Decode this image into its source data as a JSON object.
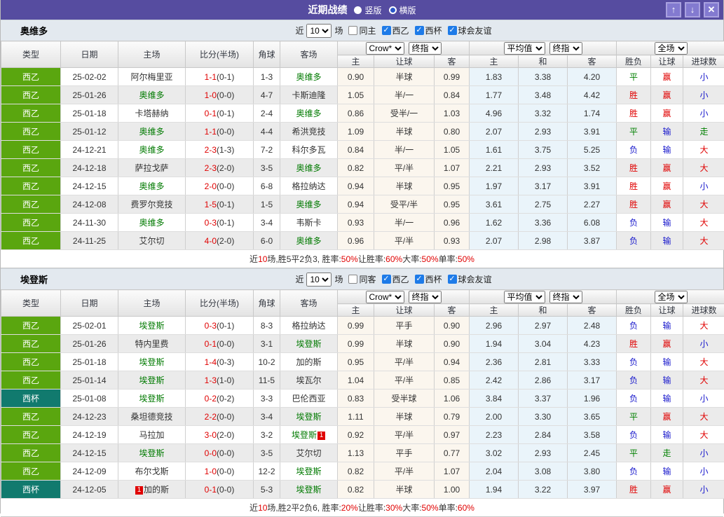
{
  "colors": {
    "titlebar_purple": "#564CA0",
    "button_purple": "#837AD0",
    "league_green": "#5AA60F",
    "league_teal": "#117A6E",
    "focus_team_green": "#007A00",
    "result_red": "#E00000",
    "result_blue": "#1818CC",
    "result_green": "#008000",
    "odds_cream_bg": "#FBF6EE",
    "avg_blue_bg": "#EAF4FA"
  },
  "result_color_map": {
    "胜": "red",
    "平": "green",
    "负": "blue",
    "赢": "red",
    "输": "blue",
    "走": "green",
    "大": "red",
    "小": "blue"
  },
  "league_style_map": {
    "西乙": "green",
    "西杯": "teal"
  },
  "titlebar": {
    "title": "近期战绩",
    "vertical_label": "竖版",
    "horizontal_label": "横版",
    "up_icon": "↑",
    "down_icon": "↓",
    "close_icon": "✕"
  },
  "controls_shared": {
    "near": "近",
    "count": "10",
    "games": "场",
    "league_cb": "西乙",
    "cup_cb": "西杯",
    "friendly_cb": "球会友谊"
  },
  "table_headers": {
    "type": "类型",
    "date": "日期",
    "home": "主场",
    "score": "比分(半场)",
    "corner": "角球",
    "away": "客场",
    "crow_select": "Crow*",
    "final_select": "终指",
    "avg_select": "平均值",
    "final_select2": "终指",
    "scope_select": "全场",
    "sub": {
      "home_odds": "主",
      "handicap": "让球",
      "away_odds": "客",
      "avg_home": "主",
      "avg_draw": "和",
      "avg_away": "客",
      "wdl": "胜负",
      "handicap_result": "让球",
      "goals": "进球数"
    }
  },
  "sections": [
    {
      "team": "奥维多",
      "same_label": "同主",
      "rows": [
        {
          "type": "西乙",
          "date": "25-02-02",
          "home": "阿尔梅里亚",
          "score": "1-1",
          "half": "(0-1)",
          "corner": "1-3",
          "away": "奥维多",
          "crow": [
            "0.90",
            "半球",
            "0.99"
          ],
          "avg": [
            "1.83",
            "3.38",
            "4.20"
          ],
          "result": [
            "平",
            "赢",
            "小"
          ]
        },
        {
          "type": "西乙",
          "date": "25-01-26",
          "home": "奥维多",
          "score": "1-0",
          "half": "(0-0)",
          "corner": "4-7",
          "away": "卡斯迪隆",
          "crow": [
            "1.05",
            "半/一",
            "0.84"
          ],
          "avg": [
            "1.77",
            "3.48",
            "4.42"
          ],
          "result": [
            "胜",
            "赢",
            "小"
          ]
        },
        {
          "type": "西乙",
          "date": "25-01-18",
          "home": "卡塔赫纳",
          "score": "0-1",
          "half": "(0-1)",
          "corner": "2-4",
          "away": "奥维多",
          "crow": [
            "0.86",
            "受半/一",
            "1.03"
          ],
          "avg": [
            "4.96",
            "3.32",
            "1.74"
          ],
          "result": [
            "胜",
            "赢",
            "小"
          ]
        },
        {
          "type": "西乙",
          "date": "25-01-12",
          "home": "奥维多",
          "score": "1-1",
          "half": "(0-0)",
          "corner": "4-4",
          "away": "希洪竞技",
          "crow": [
            "1.09",
            "半球",
            "0.80"
          ],
          "avg": [
            "2.07",
            "2.93",
            "3.91"
          ],
          "result": [
            "平",
            "输",
            "走"
          ]
        },
        {
          "type": "西乙",
          "date": "24-12-21",
          "home": "奥维多",
          "score": "2-3",
          "half": "(1-3)",
          "corner": "7-2",
          "away": "科尔多瓦",
          "crow": [
            "0.84",
            "半/一",
            "1.05"
          ],
          "avg": [
            "1.61",
            "3.75",
            "5.25"
          ],
          "result": [
            "负",
            "输",
            "大"
          ]
        },
        {
          "type": "西乙",
          "date": "24-12-18",
          "home": "萨拉戈萨",
          "score": "2-3",
          "half": "(2-0)",
          "corner": "3-5",
          "away": "奥维多",
          "crow": [
            "0.82",
            "平/半",
            "1.07"
          ],
          "avg": [
            "2.21",
            "2.93",
            "3.52"
          ],
          "result": [
            "胜",
            "赢",
            "大"
          ]
        },
        {
          "type": "西乙",
          "date": "24-12-15",
          "home": "奥维多",
          "score": "2-0",
          "half": "(0-0)",
          "corner": "6-8",
          "away": "格拉纳达",
          "crow": [
            "0.94",
            "半球",
            "0.95"
          ],
          "avg": [
            "1.97",
            "3.17",
            "3.91"
          ],
          "result": [
            "胜",
            "赢",
            "小"
          ]
        },
        {
          "type": "西乙",
          "date": "24-12-08",
          "home": "费罗尔竞技",
          "score": "1-5",
          "half": "(0-1)",
          "corner": "1-5",
          "away": "奥维多",
          "crow": [
            "0.94",
            "受平/半",
            "0.95"
          ],
          "avg": [
            "3.61",
            "2.75",
            "2.27"
          ],
          "result": [
            "胜",
            "赢",
            "大"
          ]
        },
        {
          "type": "西乙",
          "date": "24-11-30",
          "home": "奥维多",
          "score": "0-3",
          "half": "(0-1)",
          "corner": "3-4",
          "away": "韦斯卡",
          "crow": [
            "0.93",
            "半/一",
            "0.96"
          ],
          "avg": [
            "1.62",
            "3.36",
            "6.08"
          ],
          "result": [
            "负",
            "输",
            "大"
          ]
        },
        {
          "type": "西乙",
          "date": "24-11-25",
          "home": "艾尔切",
          "score": "4-0",
          "half": "(2-0)",
          "corner": "6-0",
          "away": "奥维多",
          "crow": [
            "0.96",
            "平/半",
            "0.93"
          ],
          "avg": [
            "2.07",
            "2.98",
            "3.87"
          ],
          "result": [
            "负",
            "输",
            "大"
          ]
        }
      ],
      "summary": [
        {
          "text": "近"
        },
        {
          "text": "10",
          "red": true
        },
        {
          "text": "场,胜5平2负3, 胜率:"
        },
        {
          "text": "50%",
          "red": true
        },
        {
          "text": " 让胜率:"
        },
        {
          "text": "60%",
          "red": true
        },
        {
          "text": " 大率:"
        },
        {
          "text": "50%",
          "red": true
        },
        {
          "text": " 单率:"
        },
        {
          "text": "50%",
          "red": true
        }
      ]
    },
    {
      "team": "埃登斯",
      "same_label": "同客",
      "rows": [
        {
          "type": "西乙",
          "date": "25-02-01",
          "home": "埃登斯",
          "score": "0-3",
          "half": "(0-1)",
          "corner": "8-3",
          "away": "格拉纳达",
          "crow": [
            "0.99",
            "平手",
            "0.90"
          ],
          "avg": [
            "2.96",
            "2.97",
            "2.48"
          ],
          "result": [
            "负",
            "输",
            "大"
          ]
        },
        {
          "type": "西乙",
          "date": "25-01-26",
          "home": "特内里费",
          "score": "0-1",
          "half": "(0-0)",
          "corner": "3-1",
          "away": "埃登斯",
          "crow": [
            "0.99",
            "半球",
            "0.90"
          ],
          "avg": [
            "1.94",
            "3.04",
            "4.23"
          ],
          "result": [
            "胜",
            "赢",
            "小"
          ]
        },
        {
          "type": "西乙",
          "date": "25-01-18",
          "home": "埃登斯",
          "score": "1-4",
          "half": "(0-3)",
          "corner": "10-2",
          "away": "加的斯",
          "crow": [
            "0.95",
            "平/半",
            "0.94"
          ],
          "avg": [
            "2.36",
            "2.81",
            "3.33"
          ],
          "result": [
            "负",
            "输",
            "大"
          ]
        },
        {
          "type": "西乙",
          "date": "25-01-14",
          "home": "埃登斯",
          "score": "1-3",
          "half": "(1-0)",
          "corner": "11-5",
          "away": "埃瓦尔",
          "crow": [
            "1.04",
            "平/半",
            "0.85"
          ],
          "avg": [
            "2.42",
            "2.86",
            "3.17"
          ],
          "result": [
            "负",
            "输",
            "大"
          ]
        },
        {
          "type": "西杯",
          "date": "25-01-08",
          "home": "埃登斯",
          "score": "0-2",
          "half": "(0-2)",
          "corner": "3-3",
          "away": "巴伦西亚",
          "crow": [
            "0.83",
            "受半球",
            "1.06"
          ],
          "avg": [
            "3.84",
            "3.37",
            "1.96"
          ],
          "result": [
            "负",
            "输",
            "小"
          ]
        },
        {
          "type": "西乙",
          "date": "24-12-23",
          "home": "桑坦德竞技",
          "score": "2-2",
          "half": "(0-0)",
          "corner": "3-4",
          "away": "埃登斯",
          "crow": [
            "1.11",
            "半球",
            "0.79"
          ],
          "avg": [
            "2.00",
            "3.30",
            "3.65"
          ],
          "result": [
            "平",
            "赢",
            "大"
          ]
        },
        {
          "type": "西乙",
          "date": "24-12-19",
          "home": "马拉加",
          "score": "3-0",
          "half": "(2-0)",
          "corner": "3-2",
          "away": "埃登斯",
          "away_badge": {
            "text": "1",
            "pos": "after"
          },
          "crow": [
            "0.92",
            "平/半",
            "0.97"
          ],
          "avg": [
            "2.23",
            "2.84",
            "3.58"
          ],
          "result": [
            "负",
            "输",
            "大"
          ]
        },
        {
          "type": "西乙",
          "date": "24-12-15",
          "home": "埃登斯",
          "score": "0-0",
          "half": "(0-0)",
          "corner": "3-5",
          "away": "艾尔切",
          "crow": [
            "1.13",
            "平手",
            "0.77"
          ],
          "avg": [
            "3.02",
            "2.93",
            "2.45"
          ],
          "result": [
            "平",
            "走",
            "小"
          ]
        },
        {
          "type": "西乙",
          "date": "24-12-09",
          "home": "布尔戈斯",
          "score": "1-0",
          "half": "(0-0)",
          "corner": "12-2",
          "away": "埃登斯",
          "crow": [
            "0.82",
            "平/半",
            "1.07"
          ],
          "avg": [
            "2.04",
            "3.08",
            "3.80"
          ],
          "result": [
            "负",
            "输",
            "小"
          ]
        },
        {
          "type": "西杯",
          "date": "24-12-05",
          "home": "加的斯",
          "home_badge": {
            "text": "1",
            "pos": "before"
          },
          "score": "0-1",
          "half": "(0-0)",
          "corner": "5-3",
          "away": "埃登斯",
          "crow": [
            "0.82",
            "半球",
            "1.00"
          ],
          "avg": [
            "1.94",
            "3.22",
            "3.97"
          ],
          "result": [
            "胜",
            "赢",
            "小"
          ]
        }
      ],
      "summary": [
        {
          "text": "近"
        },
        {
          "text": "10",
          "red": true
        },
        {
          "text": "场,胜2平2负6, 胜率:"
        },
        {
          "text": "20%",
          "red": true
        },
        {
          "text": " 让胜率:"
        },
        {
          "text": "30%",
          "red": true
        },
        {
          "text": " 大率:"
        },
        {
          "text": "50%",
          "red": true
        },
        {
          "text": " 单率:"
        },
        {
          "text": "60%",
          "red": true
        }
      ]
    }
  ]
}
